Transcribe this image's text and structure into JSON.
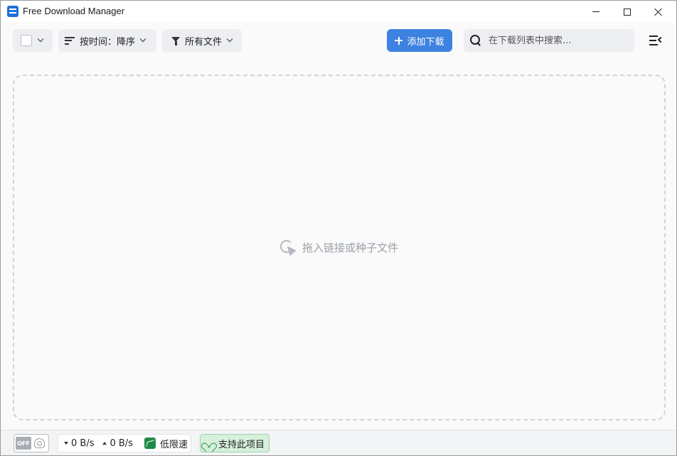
{
  "window": {
    "title": "Free Download Manager"
  },
  "toolbar": {
    "sort_label": "按时间：降序",
    "filter_label": "所有文件",
    "add_label": "添加下载",
    "search_placeholder": "在下载列表中搜索..."
  },
  "dropzone": {
    "hint": "拖入链接或种子文件"
  },
  "statusbar": {
    "snail_toggle": "OFF",
    "download_speed": "0 B/s",
    "upload_speed": "0 B/s",
    "speed_mode": "低限速",
    "support_label": "支持此项目"
  },
  "colors": {
    "accent": "#3d82e0",
    "support_bg": "#d6f0dc",
    "limit_green": "#1e8a46"
  }
}
